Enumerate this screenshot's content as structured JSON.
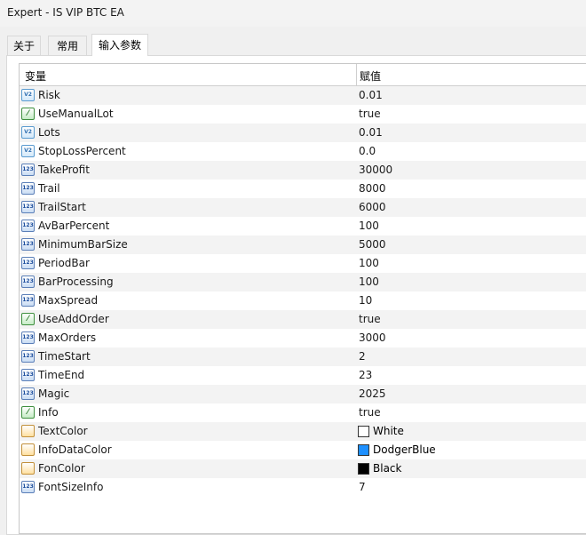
{
  "window": {
    "title": "Expert - IS VIP BTC EA"
  },
  "tabs": [
    {
      "label": "关于"
    },
    {
      "label": "常用"
    },
    {
      "label": "输入参数"
    }
  ],
  "table": {
    "columns": [
      "变量",
      "赋值"
    ],
    "rows": [
      {
        "name": "Risk",
        "value": "0.01",
        "type": "double"
      },
      {
        "name": "UseManualLot",
        "value": "true",
        "type": "bool"
      },
      {
        "name": "Lots",
        "value": "0.01",
        "type": "double"
      },
      {
        "name": "StopLossPercent",
        "value": "0.0",
        "type": "double"
      },
      {
        "name": "TakeProfit",
        "value": "30000",
        "type": "int"
      },
      {
        "name": "Trail",
        "value": "8000",
        "type": "int"
      },
      {
        "name": "TrailStart",
        "value": "6000",
        "type": "int"
      },
      {
        "name": "AvBarPercent",
        "value": "100",
        "type": "int"
      },
      {
        "name": "MinimumBarSize",
        "value": "5000",
        "type": "int"
      },
      {
        "name": "PeriodBar",
        "value": "100",
        "type": "int"
      },
      {
        "name": "BarProcessing",
        "value": "100",
        "type": "int"
      },
      {
        "name": "MaxSpread",
        "value": "10",
        "type": "int"
      },
      {
        "name": "UseAddOrder",
        "value": "true",
        "type": "bool"
      },
      {
        "name": "MaxOrders",
        "value": "3000",
        "type": "int"
      },
      {
        "name": "TimeStart",
        "value": "2",
        "type": "int"
      },
      {
        "name": "TimeEnd",
        "value": "23",
        "type": "int"
      },
      {
        "name": "Magic",
        "value": "2025",
        "type": "int"
      },
      {
        "name": "Info",
        "value": "true",
        "type": "bool"
      },
      {
        "name": "TextColor",
        "value": "White",
        "type": "color",
        "swatch": "#ffffff"
      },
      {
        "name": "InfoDataColor",
        "value": "DodgerBlue",
        "type": "color",
        "swatch": "#1e90ff"
      },
      {
        "name": "FonColor",
        "value": "Black",
        "type": "color",
        "swatch": "#000000"
      },
      {
        "name": "FontSizeInfo",
        "value": "7",
        "type": "int"
      }
    ]
  },
  "icons": {
    "int": "int-type-icon",
    "double": "double-type-icon",
    "bool": "bool-type-icon",
    "color": "color-type-icon"
  }
}
